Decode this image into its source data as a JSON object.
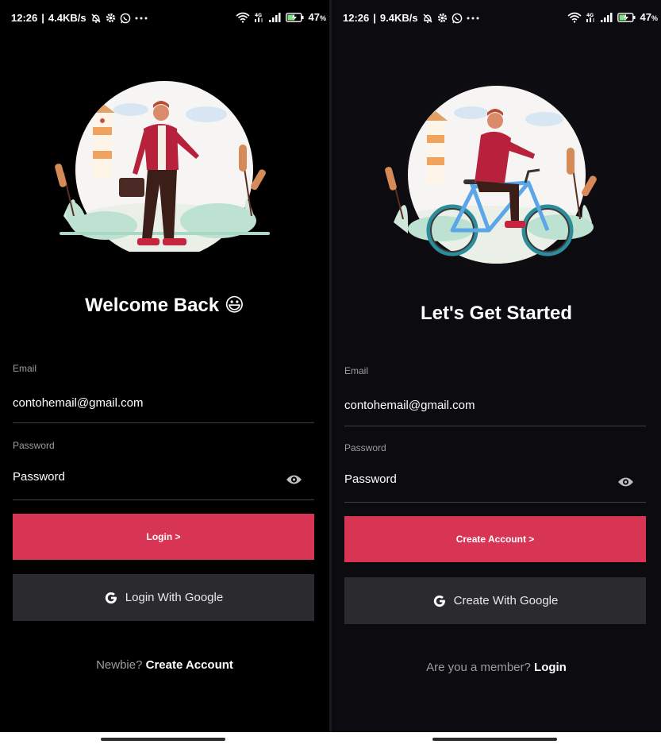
{
  "screens": [
    {
      "status": {
        "time": "12:26",
        "speed": "4.4KB/s",
        "battery": "47"
      },
      "headline": "Welcome Back",
      "headline_emoji": "😃",
      "email": {
        "label": "Email",
        "value": "contohemail@gmail.com"
      },
      "password": {
        "label": "Password",
        "placeholder": "Password"
      },
      "primary_button": "Login >",
      "google_button": "Login With Google",
      "bottom": {
        "prefix": "Newbie?",
        "link": "Create Account"
      },
      "illustration": "man-with-briefcase-illustration"
    },
    {
      "status": {
        "time": "12:26",
        "speed": "9.4KB/s",
        "battery": "47"
      },
      "headline": "Let's Get Started",
      "email": {
        "label": "Email",
        "value": "contohemail@gmail.com"
      },
      "password": {
        "label": "Password",
        "placeholder": "Password"
      },
      "primary_button": "Create Account >",
      "google_button": "Create With Google",
      "bottom": {
        "prefix": "Are you a member?",
        "link": "Login"
      },
      "illustration": "man-on-bicycle-illustration"
    }
  ],
  "colors": {
    "accent": "#d83454",
    "left_background": "#000000",
    "right_background": "#0c0b0f",
    "google_button": "#2b2a2f",
    "muted_text": "#9c9ca3"
  },
  "icons": {
    "status": [
      "do-not-disturb-icon",
      "gear-icon",
      "whatsapp-icon",
      "more-dots-icon",
      "wifi-icon",
      "4g-icon",
      "signal-icon",
      "battery-charging-icon"
    ],
    "field": "eye-icon",
    "google": "google-g-icon"
  }
}
